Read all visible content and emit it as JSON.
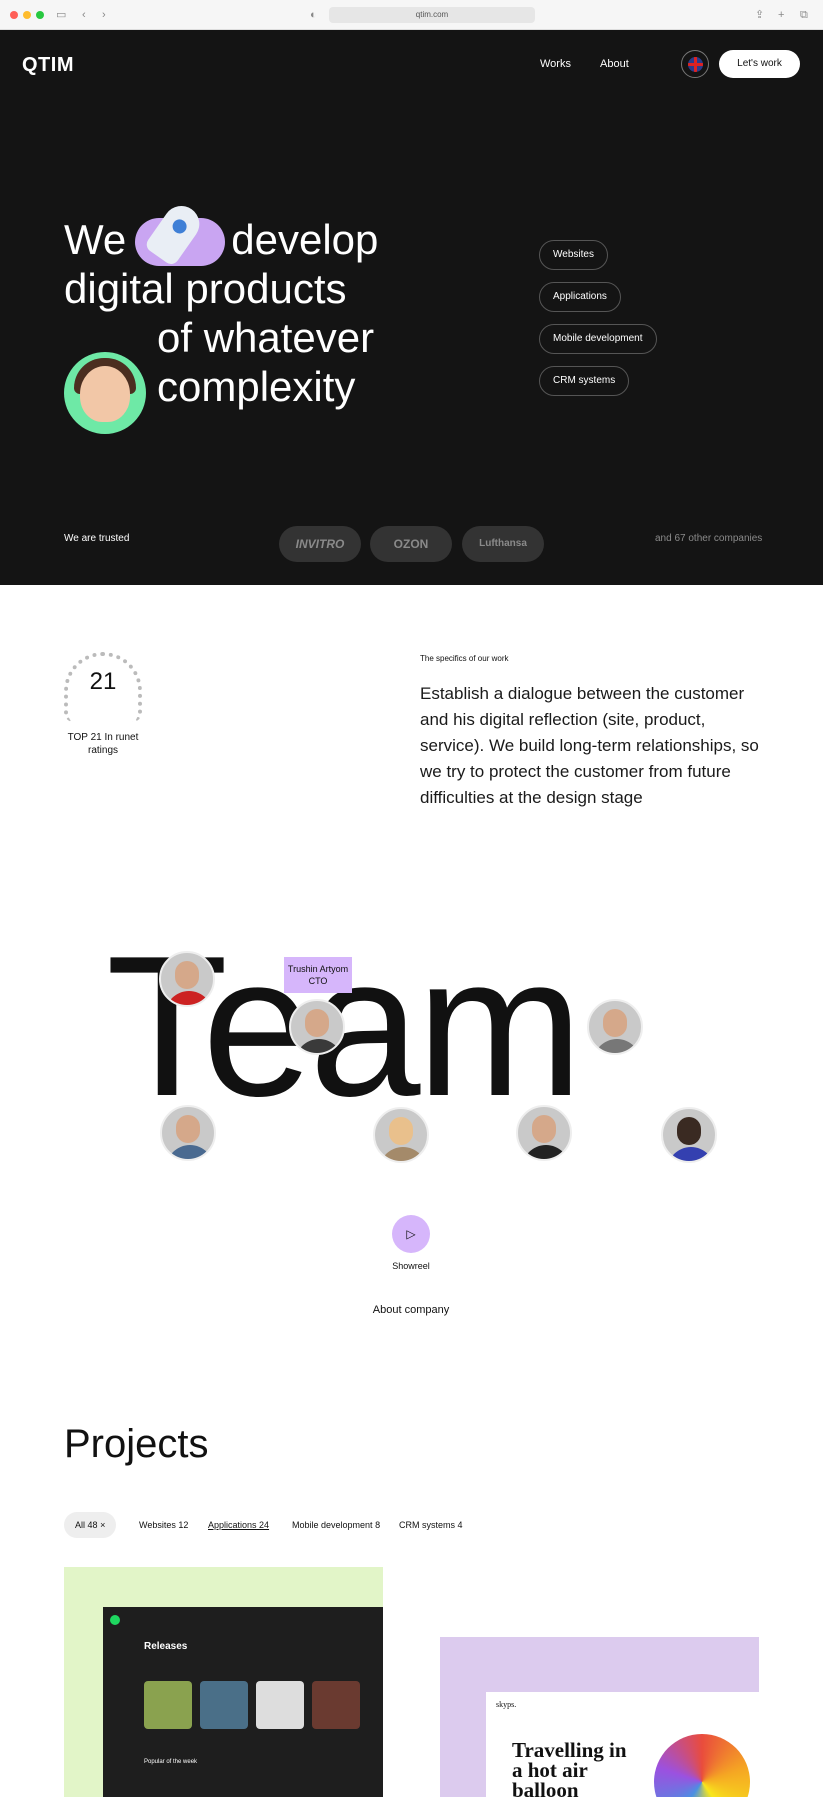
{
  "browser": {
    "url": "qtim.com"
  },
  "header": {
    "logo": "QTIM",
    "nav": [
      "Works",
      "About"
    ],
    "cta": "Let's work"
  },
  "hero": {
    "lines": [
      "We",
      "develop",
      "digital products",
      "of whatever",
      "complexity"
    ],
    "services": [
      "Websites",
      "Applications",
      "Mobile development",
      "CRM systems"
    ],
    "trusted_label": "We are trusted",
    "clients": [
      "INVITRO",
      "OZON",
      "Lufthansa"
    ],
    "others": "and 67 other companies"
  },
  "about": {
    "rating_number": "21",
    "rating_text": "TOP 21 In runet ratings",
    "specifics_label": "The specifics of our work",
    "specifics_text": "Establish a dialogue between the customer and his digital reflection (site, product, service). We build long-term relationships, so we try to protect the customer from future difficulties at the design stage"
  },
  "team": {
    "word": "Team",
    "tooltip_name": "Trushin Artyom",
    "tooltip_role": "CTO",
    "showreel": "Showreel",
    "about_company": "About company"
  },
  "projects": {
    "title": "Projects",
    "filters": [
      {
        "label": "All",
        "count": "48"
      },
      {
        "label": "Websites",
        "count": "12"
      },
      {
        "label": "Applications",
        "count": "24"
      },
      {
        "label": "Mobile development",
        "count": "8"
      },
      {
        "label": "CRM systems",
        "count": "4"
      }
    ],
    "card1_heading": "Releases",
    "card1_sub": "Popular of the week",
    "card2_brand": "skyps.",
    "card2_heading": "Travelling in a hot air balloon"
  },
  "colors": {
    "accent": "#d6b6fb",
    "green": "#6ee9a6",
    "dark": "#141414"
  }
}
